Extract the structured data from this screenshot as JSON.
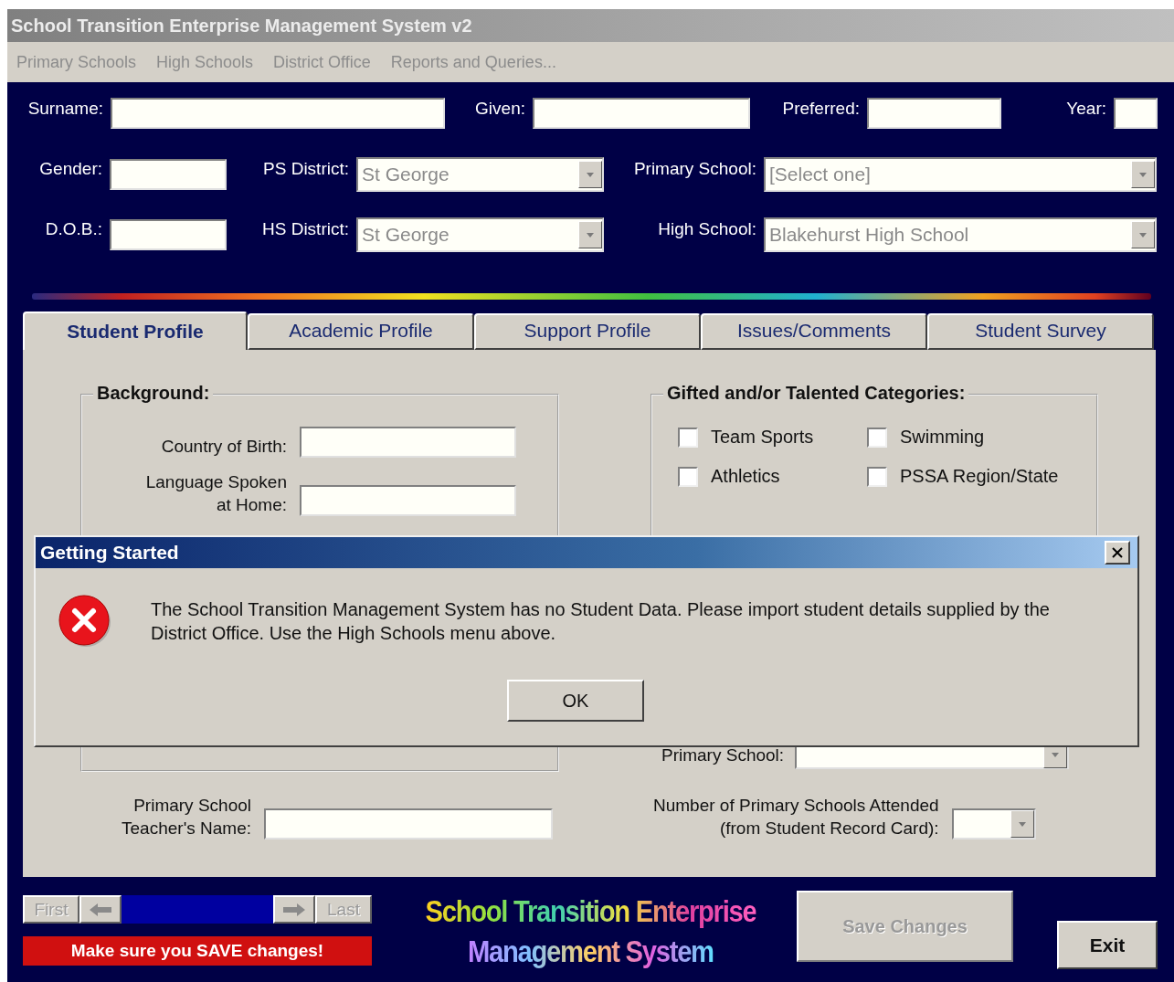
{
  "window": {
    "title": "School Transition Enterprise Management System v2"
  },
  "menu": [
    "Primary Schools",
    "High Schools",
    "District Office",
    "Reports and Queries..."
  ],
  "header_rows": [
    [
      {
        "label": "Surname:",
        "kind": "text"
      },
      {
        "label": "Given:",
        "kind": "text"
      },
      {
        "label": "Preferred:",
        "kind": "text"
      },
      {
        "label": "Year:",
        "kind": "text"
      }
    ],
    [
      {
        "label": "Gender:",
        "kind": "text"
      },
      {
        "label": "PS District:",
        "kind": "combo",
        "value": "St George"
      },
      {
        "label": "Primary School:",
        "kind": "combo",
        "value": "[Select one]"
      }
    ],
    [
      {
        "label": "D.O.B.:",
        "kind": "text"
      },
      {
        "label": "HS District:",
        "kind": "combo",
        "value": "St George"
      },
      {
        "label": "High School:",
        "kind": "combo",
        "value": "Blakehurst High School"
      }
    ]
  ],
  "tabs": [
    {
      "label": "Student Profile",
      "selected": true
    },
    {
      "label": "Academic Profile",
      "selected": false
    },
    {
      "label": "Support Profile",
      "selected": false
    },
    {
      "label": "Issues/Comments",
      "selected": false
    },
    {
      "label": "Student Survey",
      "selected": false
    }
  ],
  "background": {
    "title": "Background:",
    "fields": [
      {
        "label": "Country of Birth:"
      },
      {
        "label": "Language Spoken\nat Home:"
      }
    ]
  },
  "gifted": {
    "title": "Gifted and/or Talented Categories:",
    "options": [
      {
        "label": "Team Sports",
        "checked": false
      },
      {
        "label": "Swimming",
        "checked": false
      },
      {
        "label": "Athletics",
        "checked": false
      },
      {
        "label": "PSSA Region/State",
        "checked": false
      }
    ]
  },
  "primary_school": {
    "label": "Primary School:"
  },
  "teacher": {
    "label": "Primary School\nTeacher's Name:"
  },
  "schools_attended": {
    "label": "Number of Primary Schools Attended\n(from Student Record Card):"
  },
  "nav": {
    "first": "First",
    "last": "Last",
    "warning": "Make sure you SAVE changes!"
  },
  "logo": [
    "School Transition Enterprise",
    "Management System"
  ],
  "save": {
    "label": "Save Changes",
    "disabled": true
  },
  "exit": {
    "label": "Exit"
  },
  "dialog": {
    "title": "Getting Started",
    "message": "The School Transition Management System has no Student Data.  Please import student details supplied by the District Office.  Use the High Schools menu above.",
    "button": "OK"
  }
}
